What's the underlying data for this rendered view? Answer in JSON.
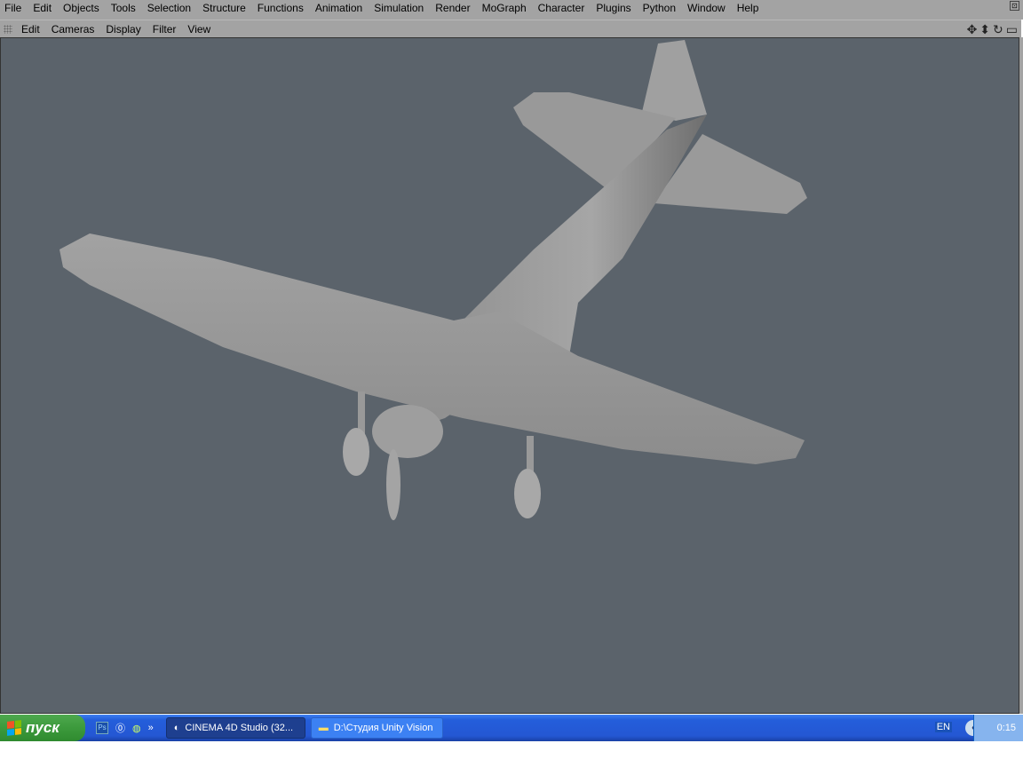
{
  "menubar": [
    "File",
    "Edit",
    "Objects",
    "Tools",
    "Selection",
    "Structure",
    "Functions",
    "Animation",
    "Simulation",
    "Render",
    "MoGraph",
    "Character",
    "Plugins",
    "Python",
    "Window",
    "Help"
  ],
  "viewport_menu": [
    "Edit",
    "Cameras",
    "Display",
    "Filter",
    "View"
  ],
  "viewport_icons": [
    "move-icon",
    "dolly-icon",
    "rotate-icon",
    "maximize-icon"
  ],
  "colors": {
    "viewport_bg": "#5b636b",
    "model": "#9a9a9a"
  },
  "taskbar": {
    "start_label": "пуск",
    "quicklaunch": [
      "Ps"
    ],
    "tasks": [
      {
        "label": "CINEMA 4D Studio (32...",
        "active": true
      },
      {
        "label": "D:\\Студия Unity Vision",
        "active": false
      }
    ],
    "lang": "EN",
    "clock": "0:15"
  }
}
